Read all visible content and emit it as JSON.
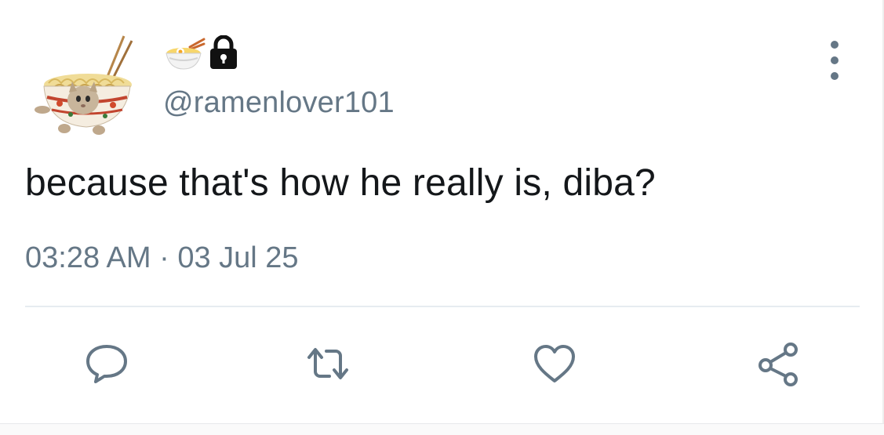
{
  "tweet": {
    "handle": "@ramenlover101",
    "display_name_icons": [
      "ramen-bowl-icon",
      "lock-icon"
    ],
    "text": "because that's how he really is, diba?",
    "time": "03:28 AM",
    "separator": "·",
    "date": "03 Jul 25"
  },
  "actions": [
    "reply-icon",
    "retweet-icon",
    "like-icon",
    "share-icon"
  ],
  "colors": {
    "text": "#14171a",
    "muted": "#657786",
    "divider": "#e6ecf0"
  }
}
